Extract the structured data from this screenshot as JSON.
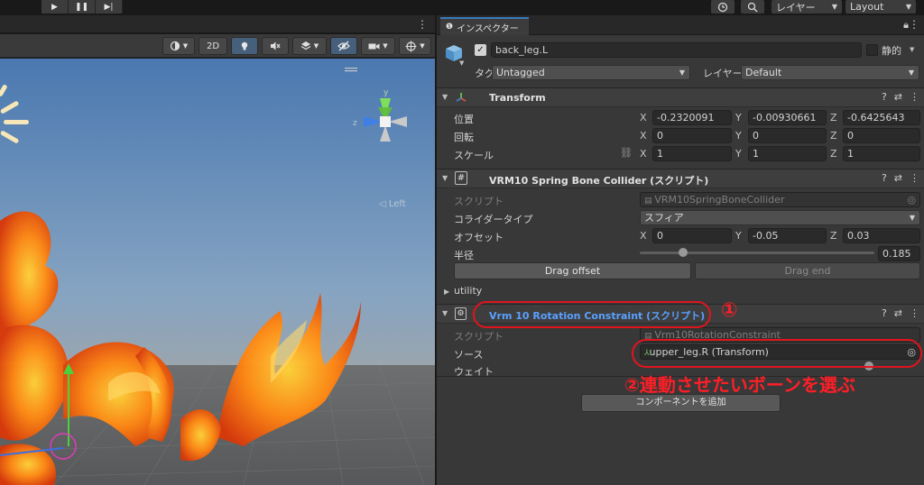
{
  "toolbar": {
    "layers_label": "レイヤー",
    "layout_label": "Layout"
  },
  "scene": {
    "toolbar": {
      "mode_2d": "2D"
    },
    "gizmo_label": "◁ Left",
    "gizmo_axes": {
      "y": "y",
      "z": "z"
    }
  },
  "inspector": {
    "tab_label": "インスペクター",
    "object": {
      "name": "back_leg.L",
      "static_label": "静的",
      "tag_label": "タグ",
      "tag_value": "Untagged",
      "layer_label": "レイヤー",
      "layer_value": "Default"
    },
    "transform": {
      "title": "Transform",
      "position_label": "位置",
      "rotation_label": "回転",
      "scale_label": "スケール",
      "position": {
        "x": "-0.2320091",
        "y": "-0.00930661",
        "z": "-0.6425643"
      },
      "rotation": {
        "x": "0",
        "y": "0",
        "z": "0"
      },
      "scale": {
        "x": "1",
        "y": "1",
        "z": "1"
      }
    },
    "collider": {
      "title": "VRM10 Spring Bone Collider (スクリプト)",
      "script_label": "スクリプト",
      "script_value": "VRM10SpringBoneCollider",
      "type_label": "コライダータイプ",
      "type_value": "スフィア",
      "offset_label": "オフセット",
      "offset": {
        "x": "0",
        "y": "-0.05",
        "z": "0.03"
      },
      "radius_label": "半径",
      "radius_value": "0.185",
      "radius_fraction": 0.185,
      "drag_offset_label": "Drag offset",
      "drag_end_label": "Drag end"
    },
    "utility_label": "utility",
    "constraint": {
      "title": "Vrm 10 Rotation Constraint (スクリプト)",
      "script_label": "スクリプト",
      "script_value": "Vrm10RotationConstraint",
      "source_label": "ソース",
      "source_value": "upper_leg.R (Transform)",
      "weight_label": "ウェイト"
    },
    "add_component_label": "コンポーネントを追加"
  },
  "annotations": {
    "step1": "①",
    "step2": "②連動させたいボーンを選ぶ"
  },
  "axis_labels": {
    "x": "X",
    "y": "Y",
    "z": "Z"
  },
  "colors": {
    "accent_blue": "#3a79bb",
    "annotation_red": "#e1141e",
    "constraint_title": "#5aa0ff"
  }
}
